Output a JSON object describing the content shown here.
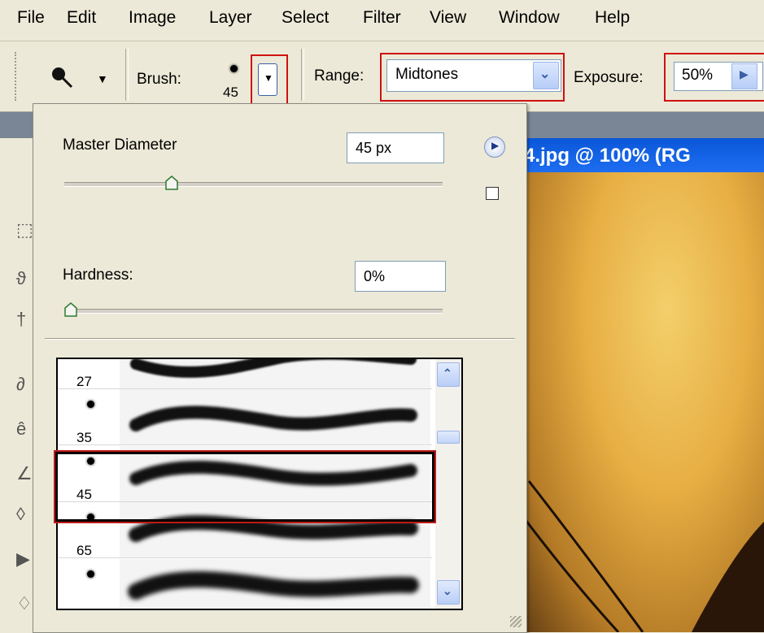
{
  "menu": [
    "File",
    "Edit",
    "Image",
    "Layer",
    "Select",
    "Filter",
    "View",
    "Window",
    "Help"
  ],
  "toolbar": {
    "tool_icon": "dodge-tool-icon",
    "brush_label": "Brush:",
    "brush_size": "45",
    "range_label": "Range:",
    "range_value": "Midtones",
    "exposure_label": "Exposure:",
    "exposure_value": "50%"
  },
  "document": {
    "title": "4.jpg @ 100% (RG"
  },
  "brush_panel": {
    "master_diameter_label": "Master Diameter",
    "master_diameter_value": "45 px",
    "master_diameter_level": 0.22,
    "hardness_label": "Hardness:",
    "hardness_value": "0%",
    "hardness_level": 0.0,
    "presets": [
      {
        "size": "27"
      },
      {
        "size": "35"
      },
      {
        "size": "45",
        "selected": true
      },
      {
        "size": "65"
      },
      {
        "size": ""
      }
    ]
  },
  "colors": {
    "highlight": "#d01010",
    "titlebar": "#0a57d9",
    "panel": "#ece9d8"
  }
}
